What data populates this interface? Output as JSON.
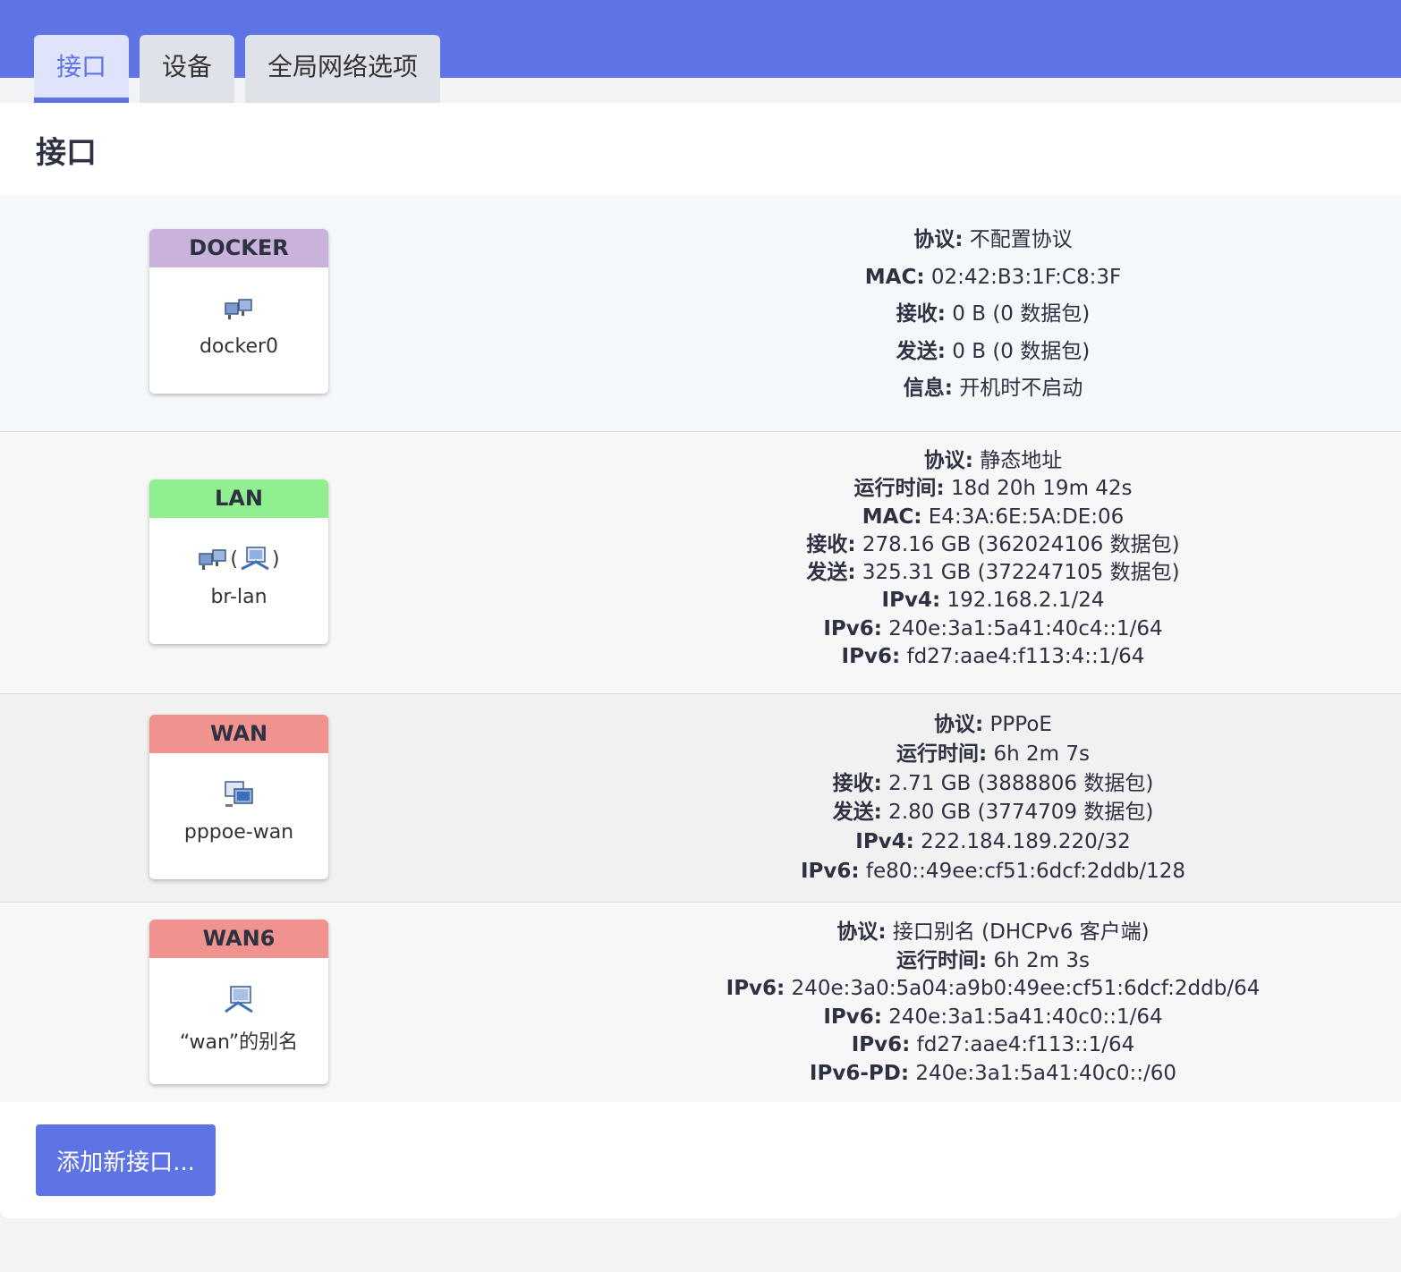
{
  "tabs": [
    {
      "label": "接口"
    },
    {
      "label": "设备"
    },
    {
      "label": "全局网络选项"
    }
  ],
  "page_title": "接口",
  "interfaces": [
    {
      "name": "DOCKER",
      "color": "#c9b2dc",
      "device": "docker0",
      "icons": [
        "ethernet-switch-icon"
      ],
      "details": [
        {
          "label": "协议:",
          "value": " 不配置协议"
        },
        {
          "label": "MAC:",
          "value": " 02:42:B3:1F:C8:3F"
        },
        {
          "label": "接收:",
          "value": " 0 B (0 数据包)"
        },
        {
          "label": "发送:",
          "value": " 0 B (0 数据包)"
        },
        {
          "label": "信息:",
          "value": " 开机时不启动"
        }
      ]
    },
    {
      "name": "LAN",
      "color": "#90f090",
      "device": "br-lan",
      "icons": [
        "ethernet-switch-icon",
        "network-adapter-icon"
      ],
      "details": [
        {
          "label": "协议:",
          "value": " 静态地址"
        },
        {
          "label": "运行时间:",
          "value": " 18d 20h 19m 42s"
        },
        {
          "label": "MAC:",
          "value": " E4:3A:6E:5A:DE:06"
        },
        {
          "label": "接收:",
          "value": " 278.16 GB (362024106 数据包)"
        },
        {
          "label": "发送:",
          "value": " 325.31 GB (372247105 数据包)"
        },
        {
          "label": "IPv4:",
          "value": " 192.168.2.1/24"
        },
        {
          "label": "IPv6:",
          "value": " 240e:3a1:5a41:40c4::1/64"
        },
        {
          "label": "IPv6:",
          "value": " fd27:aae4:f113:4::1/64"
        }
      ]
    },
    {
      "name": "WAN",
      "color": "#f0938e",
      "device": "pppoe-wan",
      "icons": [
        "tunnel-icon"
      ],
      "details": [
        {
          "label": "协议:",
          "value": " PPPoE"
        },
        {
          "label": "运行时间:",
          "value": " 6h 2m 7s"
        },
        {
          "label": "接收:",
          "value": " 2.71 GB (3888806 数据包)"
        },
        {
          "label": "发送:",
          "value": " 2.80 GB (3774709 数据包)"
        },
        {
          "label": "IPv4:",
          "value": " 222.184.189.220/32"
        },
        {
          "label": "IPv6:",
          "value": " fe80::49ee:cf51:6dcf:2ddb/128"
        }
      ]
    },
    {
      "name": "WAN6",
      "color": "#f0938e",
      "device": "“wan”的别名",
      "icons": [
        "alias-icon"
      ],
      "details": [
        {
          "label": "协议:",
          "value": " 接口别名 (DHCPv6 客户端)"
        },
        {
          "label": "运行时间:",
          "value": " 6h 2m 3s"
        },
        {
          "label": "IPv6:",
          "value": " 240e:3a0:5a04:a9b0:49ee:cf51:6dcf:2ddb/64"
        },
        {
          "label": "IPv6:",
          "value": " 240e:3a1:5a41:40c0::1/64"
        },
        {
          "label": "IPv6:",
          "value": " fd27:aae4:f113::1/64"
        },
        {
          "label": "IPv6-PD:",
          "value": " 240e:3a1:5a41:40c0::/60"
        }
      ]
    }
  ],
  "lan_paren_open": "(",
  "lan_paren_close": ")",
  "add_button_label": "添加新接口..."
}
